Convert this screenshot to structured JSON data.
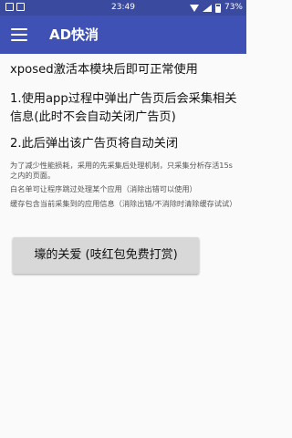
{
  "status_bar": {
    "time": "23:49",
    "battery_label": "73%",
    "battery_level": 73,
    "icons": [
      "notification-icon",
      "notification-icon",
      "wifi-icon",
      "signal-icon",
      "battery-icon"
    ]
  },
  "toolbar": {
    "menu_icon": "hamburger-menu-icon",
    "title": "AD快消",
    "background_color": "#3f51b5"
  },
  "content": {
    "line1": "xposed激活本模块后即可正常使用",
    "line2": "1.使用app过程中弹出广告页后会采集相关信息(此时不会自动关闭广告页)",
    "line3": "2.此后弹出该广告页将自动关闭",
    "note1": "为了减少性能损耗，采用的先采集后处理机制，只采集分析存活15s之内的页面。",
    "note2": "白名单可让程序跳过处理某个应用（消除出错可以使用）",
    "note3": "缓存包含当前采集到的应用信息（消除出错/不消除时清除缓存试试）"
  },
  "donate_button": {
    "label": "壕的关爱 (吱红包免费打赏)"
  }
}
